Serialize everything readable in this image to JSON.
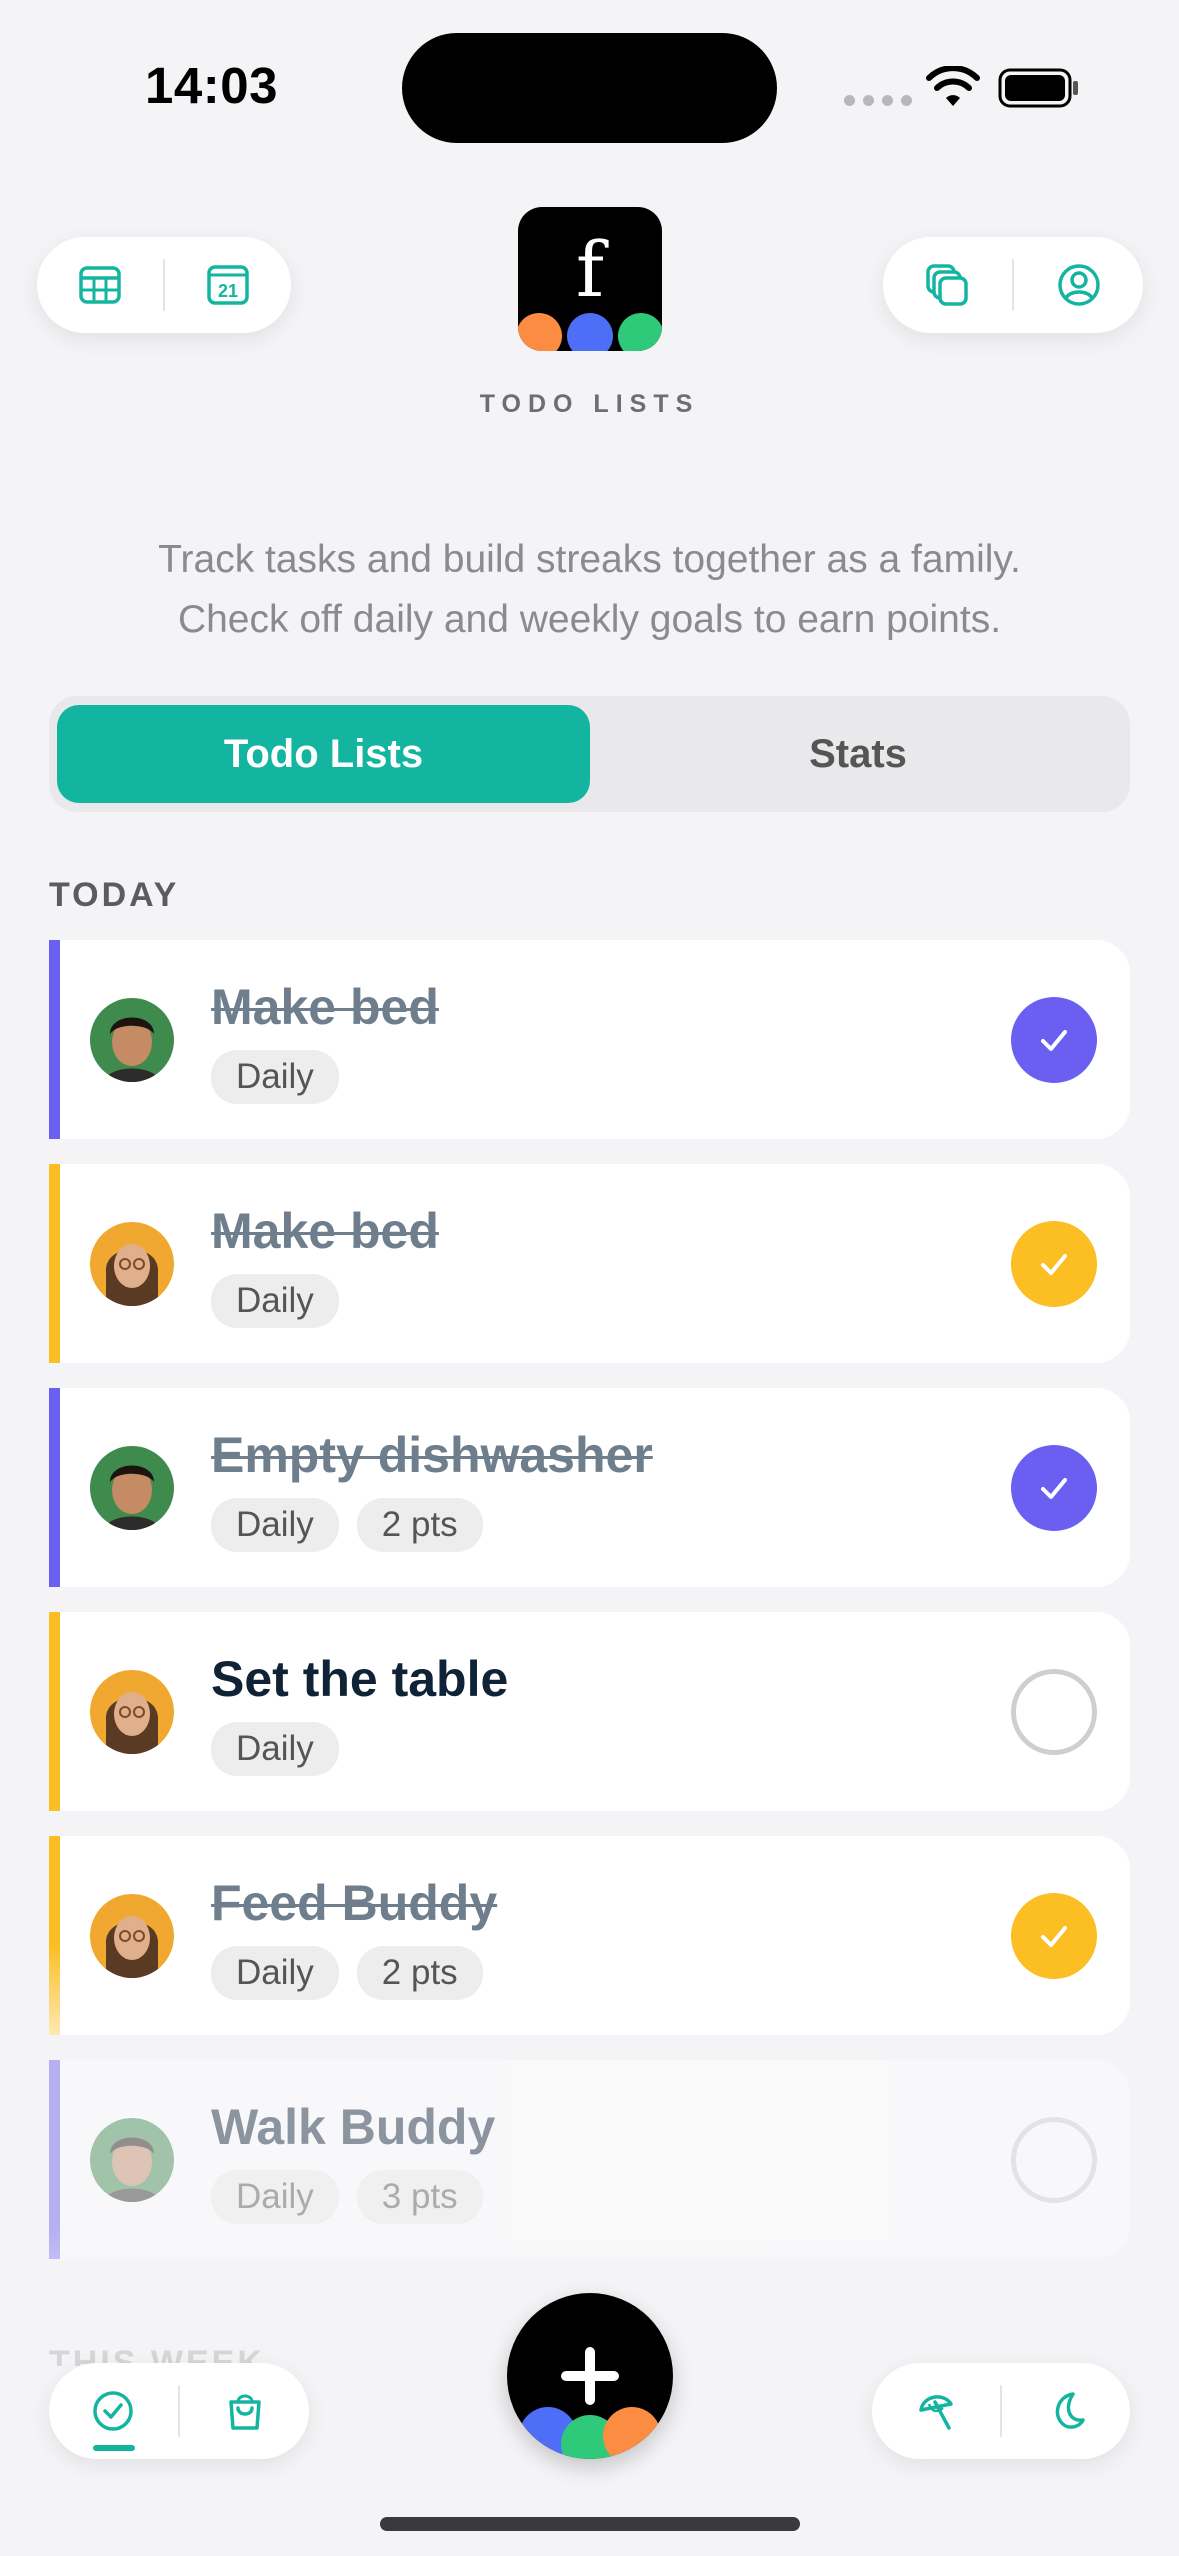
{
  "status_bar": {
    "time": "14:03"
  },
  "header": {
    "app_logo_letter": "f",
    "app_title": "TODO LISTS",
    "tagline_line1": "Track tasks and build streaks together as a family.",
    "tagline_line2": "Check off daily and weekly goals to earn points.",
    "calendar_day": "21"
  },
  "tabs": {
    "active": "Todo Lists",
    "inactive": "Stats"
  },
  "sections": {
    "today": "TODAY",
    "this_week": "THIS WEEK"
  },
  "todos": [
    {
      "title": "Make bed",
      "tags": [
        "Daily"
      ],
      "done": true,
      "color": "#6a5ff0",
      "avatar": "boy"
    },
    {
      "title": "Make bed",
      "tags": [
        "Daily"
      ],
      "done": true,
      "color": "#fbbf24",
      "avatar": "girl"
    },
    {
      "title": "Empty dishwasher",
      "tags": [
        "Daily",
        "2 pts"
      ],
      "done": true,
      "color": "#6a5ff0",
      "avatar": "boy"
    },
    {
      "title": "Set the table",
      "tags": [
        "Daily"
      ],
      "done": false,
      "color": "#fbbf24",
      "avatar": "girl"
    },
    {
      "title": "Feed Buddy",
      "tags": [
        "Daily",
        "2 pts"
      ],
      "done": true,
      "color": "#fbbf24",
      "avatar": "girl"
    },
    {
      "title": "Walk Buddy",
      "tags": [
        "Daily",
        "3 pts"
      ],
      "done": false,
      "color": "#6a5ff0",
      "avatar": "boy"
    }
  ],
  "colors": {
    "accent": "#13b5a0",
    "purple": "#6a5ff0",
    "yellow": "#fbbf24",
    "logo_orange": "#fb8c42",
    "logo_blue": "#4f6ef7",
    "logo_green": "#2fc97a"
  },
  "icons": {
    "header_left": [
      "grid-calendar-icon",
      "calendar-day-icon"
    ],
    "header_right": [
      "stacked-cards-icon",
      "profile-icon"
    ],
    "bottom_left": [
      "checkmark-circle-icon",
      "shopping-bag-icon"
    ],
    "bottom_right": [
      "beach-umbrella-icon",
      "moon-icon"
    ],
    "fab": "plus-icon"
  }
}
